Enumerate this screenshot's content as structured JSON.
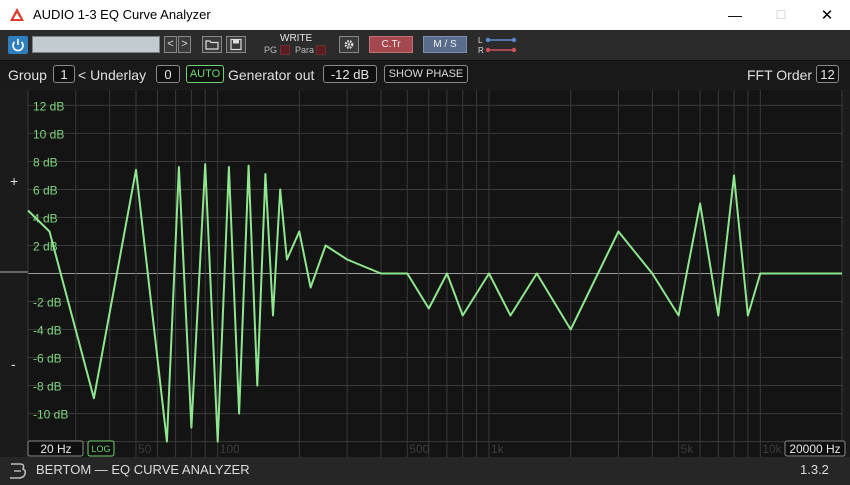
{
  "window": {
    "title": "AUDIO 1-3 EQ Curve Analyzer",
    "minimize_glyph": "—",
    "maximize_glyph": "☐",
    "close_glyph": "✕"
  },
  "toolbar": {
    "preset_value": "",
    "prev_glyph": "<",
    "next_glyph": ">",
    "write_label": "WRITE",
    "pg_label": "PG",
    "para_label": "Para",
    "ctr_label": "C.Tr",
    "ms_label": "M / S",
    "l_label": "L",
    "r_label": "R",
    "icons": [
      "power-icon",
      "folder-icon",
      "save-icon",
      "gear-icon",
      "routing-icon"
    ]
  },
  "controls": {
    "group_label": "Group",
    "group_value": "1",
    "underlay_label": "< Underlay",
    "underlay_value": "0",
    "auto_label": "AUTO",
    "generator_label": "Generator out",
    "generator_value": "-12 dB",
    "show_phase_label": "SHOW PHASE",
    "fft_order_label": "FFT Order",
    "fft_order_value": "12"
  },
  "side": {
    "plus": "+",
    "minus": "-"
  },
  "plot": {
    "db_labels": [
      "12 dB",
      "10 dB",
      "8 dB",
      "6 dB",
      "4 dB",
      "2 dB",
      "-2 dB",
      "-4 dB",
      "-6 dB",
      "-8 dB",
      "-10 dB"
    ],
    "freq_labels": [
      "50",
      "100",
      "500",
      "1k",
      "5k",
      "10k"
    ],
    "freq_min_label": "20 Hz",
    "freq_max_label": "20000 Hz",
    "log_label": "LOG",
    "curve_color": "#8ee68e",
    "grid_color": "#3a3a3a",
    "label_color": "#7fd67f"
  },
  "chart_data": {
    "type": "line",
    "xlabel": "",
    "ylabel": "",
    "x_scale": "log",
    "xlim": [
      20,
      20000
    ],
    "ylim": [
      -12,
      12
    ],
    "series": [
      {
        "x": [
          20,
          24,
          35,
          50,
          65,
          72,
          80,
          90,
          100,
          110,
          120,
          130,
          140,
          150,
          160,
          170,
          180,
          200,
          220,
          250,
          300,
          400,
          500,
          600,
          700,
          800,
          1000,
          1200,
          1500,
          2000,
          3000,
          4000,
          5000,
          6000,
          7000,
          8000,
          9000,
          10000,
          20000
        ],
        "y": [
          4.5,
          3,
          -8.9,
          7.4,
          -12,
          7.6,
          -11,
          7.8,
          -12,
          7.6,
          -10,
          7.7,
          -8,
          7.1,
          -3,
          6,
          1,
          3,
          -1,
          2,
          1,
          0,
          0,
          -2.5,
          0,
          -3,
          0,
          -3,
          0,
          -4,
          3,
          0,
          -3,
          5,
          -3,
          7,
          -3,
          0,
          0
        ]
      }
    ]
  },
  "footer": {
    "brand": "BERTOM — EQ CURVE ANALYZER",
    "version": "1.3.2"
  }
}
